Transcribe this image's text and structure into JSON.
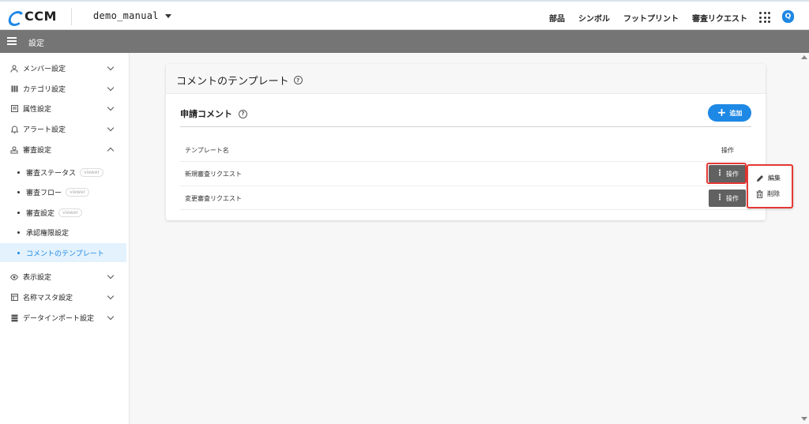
{
  "header": {
    "logo_text": "CCM",
    "project": "demo_manual",
    "nav": [
      "部品",
      "シンボル",
      "フットプリント",
      "審査リクエスト"
    ],
    "avatar_letter": "Q"
  },
  "titlebar": {
    "title": "設定"
  },
  "sidebar": {
    "items": [
      {
        "label": "メンバー設定",
        "icon": "user-icon"
      },
      {
        "label": "カテゴリ設定",
        "icon": "category-icon"
      },
      {
        "label": "属性設定",
        "icon": "attribute-icon"
      },
      {
        "label": "アラート設定",
        "icon": "bell-icon"
      },
      {
        "label": "審査設定",
        "icon": "review-icon"
      },
      {
        "label": "表示設定",
        "icon": "eye-icon"
      },
      {
        "label": "名称マスタ設定",
        "icon": "master-icon"
      },
      {
        "label": "データインポート設定",
        "icon": "database-icon"
      }
    ],
    "sub_items": [
      {
        "label": "審査ステータス",
        "badge": "viewer"
      },
      {
        "label": "審査フロー",
        "badge": "viewer"
      },
      {
        "label": "審査設定",
        "badge": "viewer"
      },
      {
        "label": "承認権限設定",
        "badge": ""
      },
      {
        "label": "コメントのテンプレート",
        "badge": ""
      }
    ]
  },
  "card": {
    "title": "コメントのテンプレート",
    "section_title": "申請コメント",
    "add_label": "追加",
    "columns": {
      "name": "テンプレート名",
      "actions": "操作"
    },
    "rows": [
      {
        "name": "新規審査リクエスト",
        "action_label": "操作"
      },
      {
        "name": "変更審査リクエスト",
        "action_label": "操作"
      }
    ]
  },
  "menu": {
    "edit": "編集",
    "delete": "削除"
  },
  "colors": {
    "accent": "#1e88e5",
    "highlight": "#e53935",
    "titlebar": "#757575",
    "action_button": "#616161"
  }
}
